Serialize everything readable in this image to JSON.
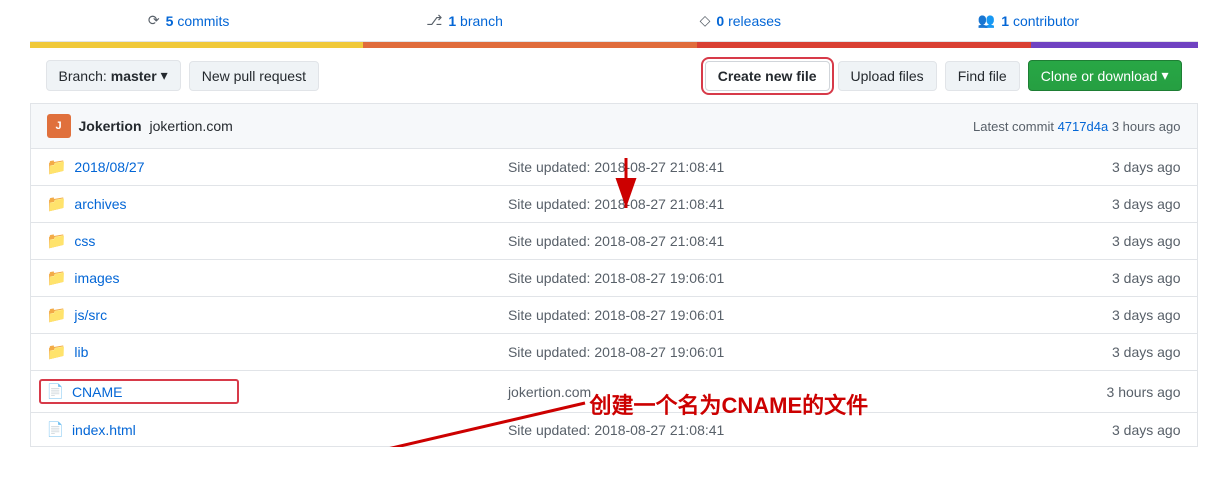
{
  "topbar": {
    "commits_icon": "⟳",
    "commits_count": "5",
    "commits_label": "commits",
    "branch_icon": "⎇",
    "branch_count": "1",
    "branch_label": "branch",
    "releases_icon": "◇",
    "releases_count": "0",
    "releases_label": "releases",
    "contributors_icon": "👥",
    "contributors_count": "1",
    "contributors_label": "contributor"
  },
  "toolbar": {
    "branch_label": "Branch:",
    "branch_name": "master",
    "new_pull_request": "New pull request",
    "create_new_file": "Create new file",
    "upload_files": "Upload files",
    "find_file": "Find file",
    "clone_or_download": "Clone or download",
    "clone_dropdown_icon": "▾"
  },
  "repo_info": {
    "avatar_text": "J",
    "username": "Jokertion",
    "domain": "jokertion.com",
    "latest_commit_label": "Latest commit",
    "commit_hash": "4717d4a",
    "time_ago": "3 hours ago"
  },
  "files": [
    {
      "type": "folder",
      "name": "2018/08/27",
      "commit_msg": "Site updated: 2018-08-27 21:08:41",
      "time": "3 days ago"
    },
    {
      "type": "folder",
      "name": "archives",
      "commit_msg": "Site updated: 2018-08-27 21:08:41",
      "time": "3 days ago"
    },
    {
      "type": "folder",
      "name": "css",
      "commit_msg": "Site updated: 2018-08-27 21:08:41",
      "time": "3 days ago"
    },
    {
      "type": "folder",
      "name": "images",
      "commit_msg": "Site updated: 2018-08-27 19:06:01",
      "time": "3 days ago"
    },
    {
      "type": "folder",
      "name": "js/src",
      "commit_msg": "Site updated: 2018-08-27 19:06:01",
      "time": "3 days ago"
    },
    {
      "type": "folder",
      "name": "lib",
      "commit_msg": "Site updated: 2018-08-27 19:06:01",
      "time": "3 days ago"
    },
    {
      "type": "file",
      "name": "CNAME",
      "commit_msg": "jokertion.com",
      "time": "3 hours ago",
      "highlight": true
    },
    {
      "type": "file",
      "name": "index.html",
      "commit_msg": "Site updated: 2018-08-27 21:08:41",
      "time": "3 days ago"
    }
  ],
  "annotation": {
    "text": "创建一个名为CNAME的文件"
  }
}
